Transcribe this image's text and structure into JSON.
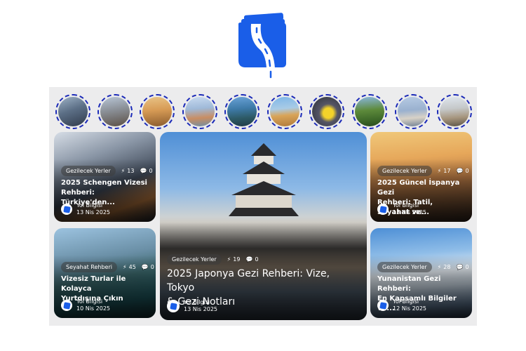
{
  "brand": {
    "accent": "#1a5ee8",
    "logo_icon": "book-road-icon"
  },
  "stories": [
    {
      "name": "airport-story"
    },
    {
      "name": "city-story"
    },
    {
      "name": "cathedral-story"
    },
    {
      "name": "harbor-story"
    },
    {
      "name": "coast-story"
    },
    {
      "name": "pyramids-story"
    },
    {
      "name": "taxi-story"
    },
    {
      "name": "island-story"
    },
    {
      "name": "mosque-story"
    },
    {
      "name": "church-story"
    }
  ],
  "cards": [
    {
      "tag": "Gezilecek Yerler",
      "likes": "13",
      "comments": "0",
      "title": "2025 Schengen Vizesi\nRehberi: Türkiye'den...",
      "author": "Yol Bilgisi",
      "date": "13 Nis 2025"
    },
    {
      "tag": "Seyahat Rehberi",
      "likes": "45",
      "comments": "0",
      "title": "Vizesiz Turlar ile Kolayca\nYurtdışına Çıkın",
      "author": "Yol Bilgisi",
      "date": "10 Nis 2025"
    },
    {
      "tag": "Gezilecek Yerler",
      "likes": "19",
      "comments": "0",
      "title": "2025 Japonya Gezi Rehberi: Vize, Tokyo\n& Gezi Notları",
      "author": "Yol Bilgisi",
      "date": "13 Nis 2025"
    },
    {
      "tag": "Gezilecek Yerler",
      "likes": "17",
      "comments": "0",
      "title": "2025 Güncel İspanya Gezi\nRehberi: Tatil, Seyahat ve...",
      "author": "Yol Bilgisi",
      "date": "13 Nis 2025"
    },
    {
      "tag": "Gezilecek Yerler",
      "likes": "28",
      "comments": "0",
      "title": "Yunanistan Gezi Rehberi:\nEn Kapsamlı Bilgiler ve...",
      "author": "Yol Bilgisi",
      "date": "12 Nis 2025"
    }
  ]
}
